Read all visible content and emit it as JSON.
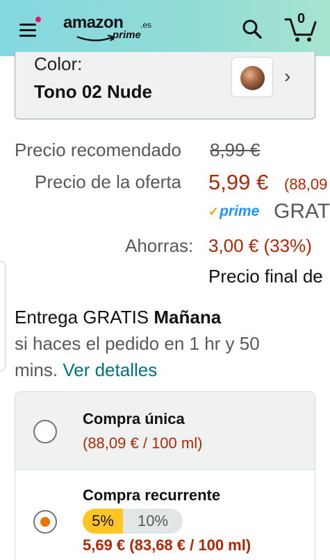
{
  "header": {
    "logo_word": "amazon",
    "logo_tld": ".es",
    "logo_prime": "prime",
    "cart_count": "0"
  },
  "variant": {
    "label": "Color:",
    "value": "Tono 02 Nude"
  },
  "pricing": {
    "recommended_label": "Precio recomendado",
    "recommended_price": "8,99 €",
    "offer_label": "Precio de la oferta",
    "offer_price": "5,99 €",
    "offer_unit_price": "(88,09",
    "prime_text": "prime",
    "shipping_text": "GRAT",
    "savings_label": "Ahorras:",
    "savings_value": "3,00 € (33%)",
    "final_price_text": "Precio final de"
  },
  "delivery": {
    "prefix": "Entrega GRATIS ",
    "day": "Mañana",
    "line2": "si haces el pedido en 1 hr y 50",
    "line3": "mins. ",
    "details_link": "Ver detalles"
  },
  "purchase_options": [
    {
      "title": "Compra única",
      "subtitle": "(88,09 € / 100 ml)",
      "selected": false
    },
    {
      "title": "Compra recurrente",
      "discount_selected": "5%",
      "discount_other": "10%",
      "price": "5,69 € (83,68 € / 100 ml)",
      "selected": true
    }
  ],
  "colors": {
    "header_gradient_start": "#84d8e0",
    "header_gradient_end": "#a6e4cf",
    "price_red": "#b12704",
    "link": "#007185",
    "prime_blue": "#1a98ff",
    "radio_selected": "#e77600",
    "discount_pill": "#ffc524"
  }
}
